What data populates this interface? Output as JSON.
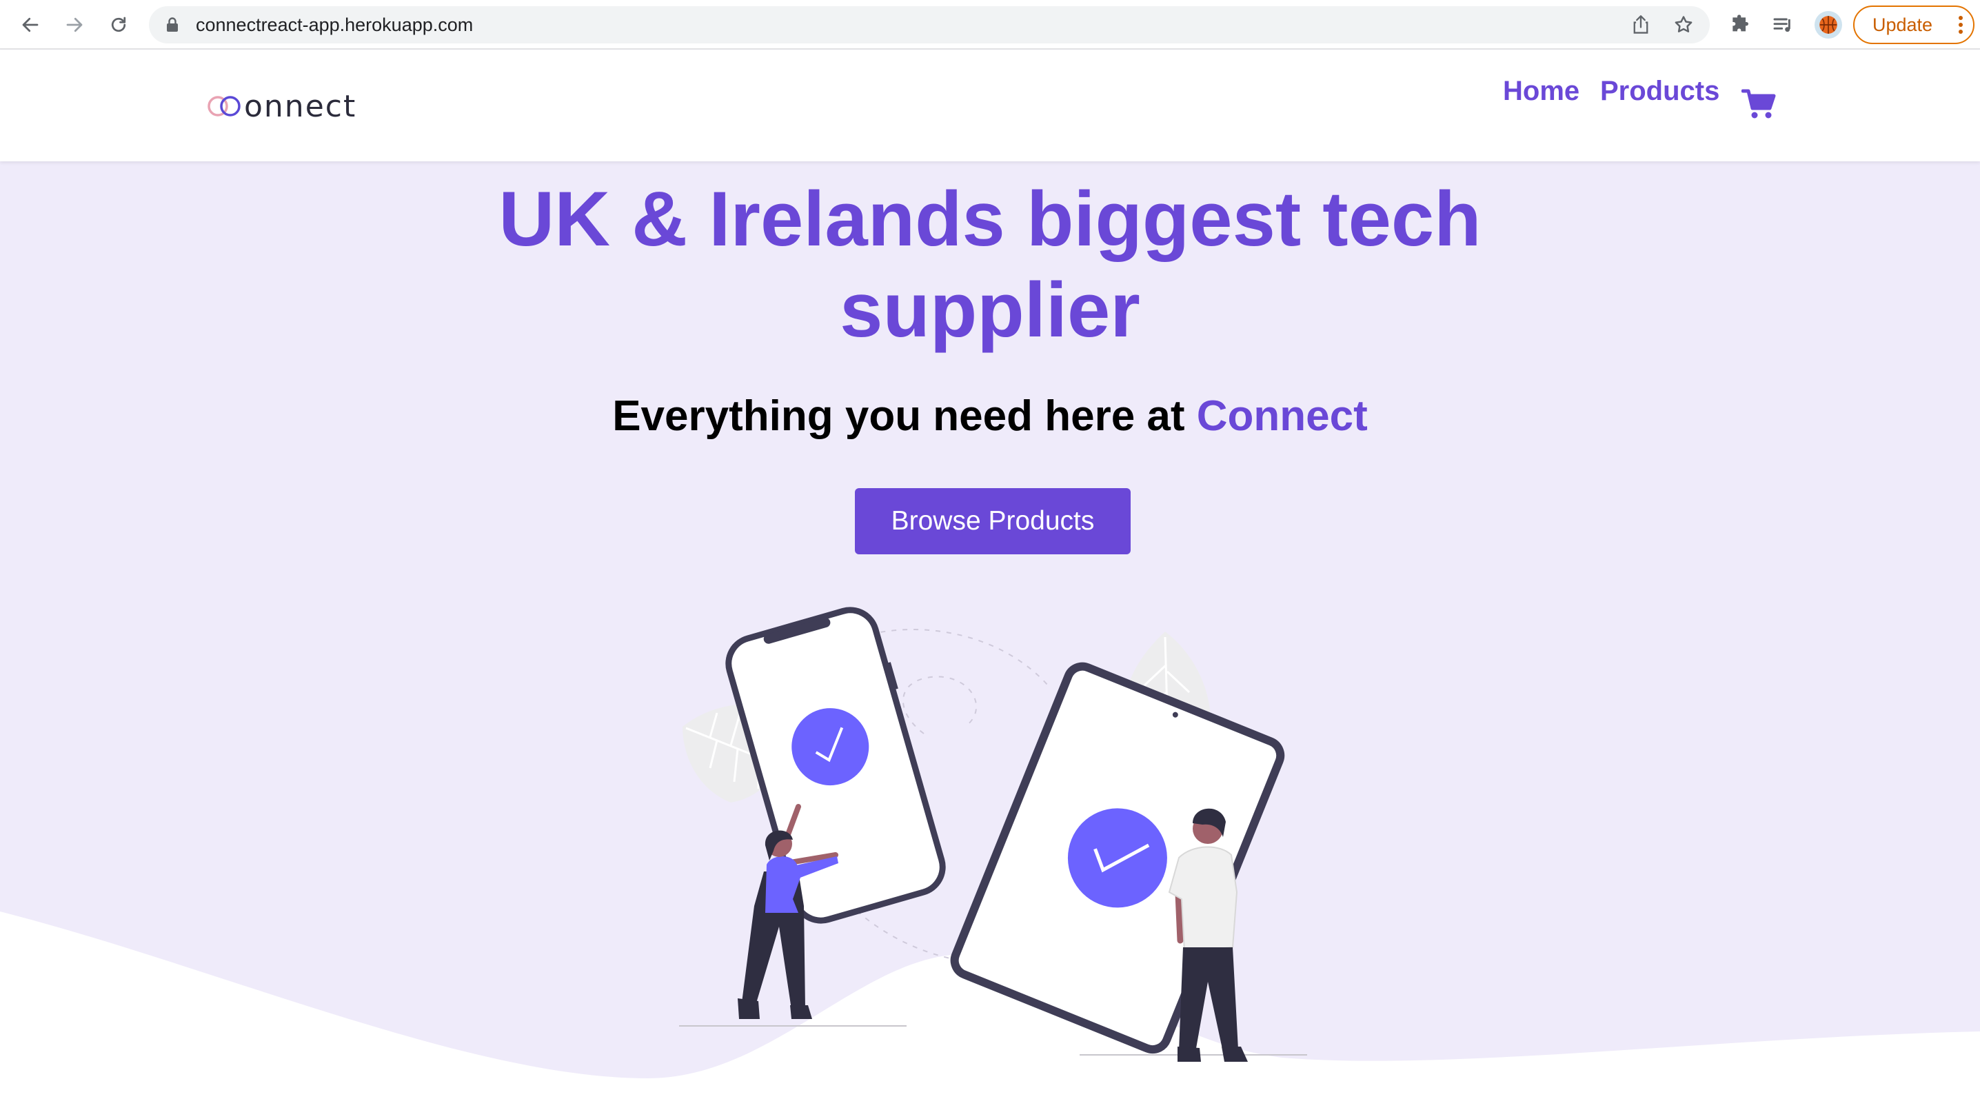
{
  "browser": {
    "url": "connectreact-app.herokuapp.com",
    "update_label": "Update",
    "icons": [
      "back-icon",
      "forward-icon",
      "reload-icon",
      "lock-icon",
      "share-icon",
      "bookmark-star-icon",
      "extensions-puzzle-icon",
      "reading-list-icon",
      "profile-avatar",
      "more-dots-icon"
    ]
  },
  "site": {
    "logo_text": "onnect",
    "nav": {
      "home": "Home",
      "products": "Products"
    },
    "cart_icon": "cart-icon"
  },
  "hero": {
    "title": "UK & Irelands biggest tech supplier",
    "subtitle_prefix": "Everything you need here at ",
    "subtitle_brand": "Connect",
    "cta_label": "Browse Products"
  },
  "colors": {
    "accent": "#6a48d7",
    "hero_background": "#efebfa",
    "illustration_accent": "#6c63ff",
    "update_orange": "#e37400"
  }
}
